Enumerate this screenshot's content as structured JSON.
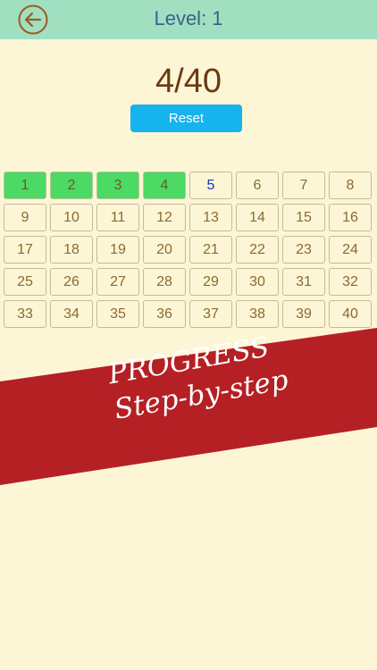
{
  "header": {
    "title": "Level: 1",
    "back_icon": "back-arrow-icon"
  },
  "progress": {
    "text": "4/40",
    "completed": 4,
    "total": 40
  },
  "reset_label": "Reset",
  "levels": [
    {
      "n": "1",
      "state": "done"
    },
    {
      "n": "2",
      "state": "done"
    },
    {
      "n": "3",
      "state": "done"
    },
    {
      "n": "4",
      "state": "done"
    },
    {
      "n": "5",
      "state": "current"
    },
    {
      "n": "6",
      "state": "locked"
    },
    {
      "n": "7",
      "state": "locked"
    },
    {
      "n": "8",
      "state": "locked"
    },
    {
      "n": "9",
      "state": "locked"
    },
    {
      "n": "10",
      "state": "locked"
    },
    {
      "n": "11",
      "state": "locked"
    },
    {
      "n": "12",
      "state": "locked"
    },
    {
      "n": "13",
      "state": "locked"
    },
    {
      "n": "14",
      "state": "locked"
    },
    {
      "n": "15",
      "state": "locked"
    },
    {
      "n": "16",
      "state": "locked"
    },
    {
      "n": "17",
      "state": "locked"
    },
    {
      "n": "18",
      "state": "locked"
    },
    {
      "n": "19",
      "state": "locked"
    },
    {
      "n": "20",
      "state": "locked"
    },
    {
      "n": "21",
      "state": "locked"
    },
    {
      "n": "22",
      "state": "locked"
    },
    {
      "n": "23",
      "state": "locked"
    },
    {
      "n": "24",
      "state": "locked"
    },
    {
      "n": "25",
      "state": "locked"
    },
    {
      "n": "26",
      "state": "locked"
    },
    {
      "n": "27",
      "state": "locked"
    },
    {
      "n": "28",
      "state": "locked"
    },
    {
      "n": "29",
      "state": "locked"
    },
    {
      "n": "30",
      "state": "locked"
    },
    {
      "n": "31",
      "state": "locked"
    },
    {
      "n": "32",
      "state": "locked"
    },
    {
      "n": "33",
      "state": "locked"
    },
    {
      "n": "34",
      "state": "locked"
    },
    {
      "n": "35",
      "state": "locked"
    },
    {
      "n": "36",
      "state": "locked"
    },
    {
      "n": "37",
      "state": "locked"
    },
    {
      "n": "38",
      "state": "locked"
    },
    {
      "n": "39",
      "state": "locked"
    },
    {
      "n": "40",
      "state": "locked"
    }
  ],
  "banner": {
    "line1": "PROGRESS",
    "line2": "Step-by-step"
  },
  "colors": {
    "background": "#fdf6d6",
    "header": "#a0dfc0",
    "done": "#4cd964",
    "reset": "#17b3ee",
    "banner": "#b52025"
  }
}
